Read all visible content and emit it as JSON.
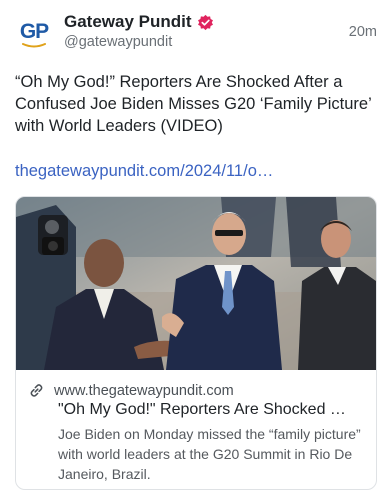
{
  "post": {
    "author": {
      "display_name": "Gateway Pundit",
      "handle": "@gatewaypundit",
      "avatar_text": "GP",
      "verified": true,
      "verified_color": "#e0245e"
    },
    "timestamp": "20m",
    "text": "“Oh My God!” Reporters Are Shocked After a Confused Joe Biden Misses G20 ‘Family Picture’ with World Leaders (VIDEO)",
    "link_text": "thegatewaypundit.com/2024/11/o…",
    "link_color": "#3b63c2"
  },
  "link_card": {
    "domain": "www.thegatewaypundit.com",
    "title": "\"Oh My God!\" Reporters Are Shocked …",
    "description": "Joe Biden on Monday missed the “family picture” with world leaders at the G20 Summit in Rio De Janeiro, Brazil.",
    "icons": {
      "link": "link-icon"
    },
    "image": "photo of men in suits greeting outdoors"
  }
}
